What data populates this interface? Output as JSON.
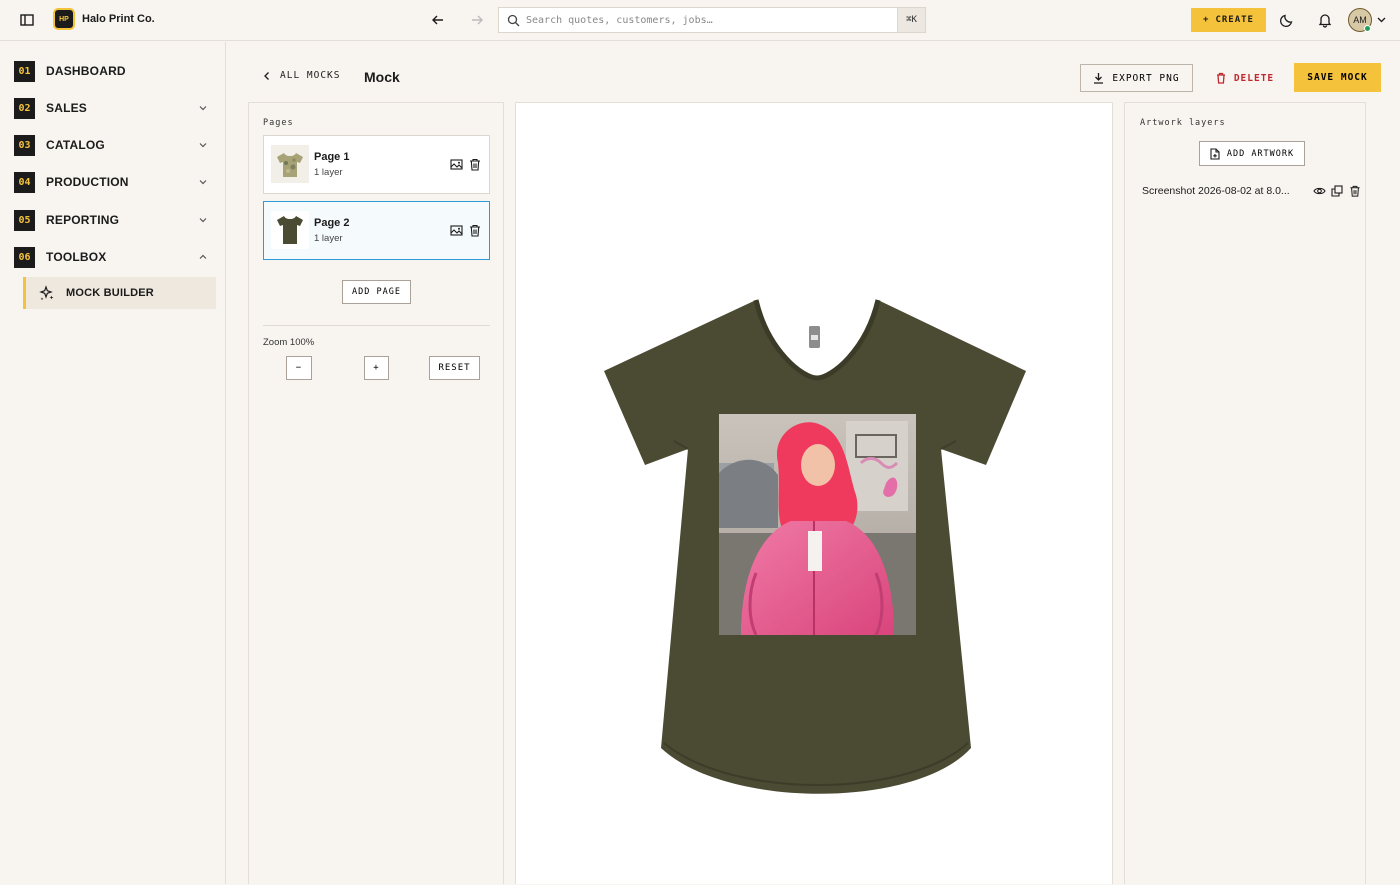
{
  "topbar": {
    "brand_initials": "HP",
    "brand_name": "Halo Print Co.",
    "search_placeholder": "Search quotes, customers, jobs…",
    "search_shortcut": "⌘K",
    "create_label": "CREATE",
    "avatar_initials": "AM",
    "icons": [
      "sidebar-toggle-icon",
      "arrow-left-icon",
      "arrow-right-icon",
      "search-icon",
      "plus-icon",
      "moon-icon",
      "bell-icon",
      "chevron-down-icon"
    ]
  },
  "sidebar": {
    "items": [
      {
        "num": "01",
        "label": "DASHBOARD"
      },
      {
        "num": "02",
        "label": "SALES"
      },
      {
        "num": "03",
        "label": "CATALOG"
      },
      {
        "num": "04",
        "label": "PRODUCTION"
      },
      {
        "num": "05",
        "label": "REPORTING"
      },
      {
        "num": "06",
        "label": "TOOLBOX"
      }
    ],
    "sub_item": "MOCK BUILDER"
  },
  "header": {
    "back_label": "ALL MOCKS",
    "title": "Mock",
    "export_label": "EXPORT PNG",
    "delete_label": "DELETE",
    "save_label": "SAVE MOCK"
  },
  "pages_panel": {
    "title": "Pages",
    "pages": [
      {
        "name": "Page 1",
        "layers": "1 layer"
      },
      {
        "name": "Page 2",
        "layers": "1 layer"
      }
    ],
    "add_page_label": "ADD PAGE",
    "zoom_label": "Zoom 100%",
    "zoom_out": "−",
    "zoom_in": "+",
    "reset_label": "RESET"
  },
  "artwork_panel": {
    "title": "Artwork layers",
    "add_label": "ADD ARTWORK",
    "layers": [
      {
        "name": "Screenshot 2026-08-02 at 8.0..."
      }
    ]
  },
  "colors": {
    "accent": "#f5c33b",
    "shirt": "#4b4a33",
    "danger": "#c0272d",
    "selected": "#2f9bd6"
  }
}
